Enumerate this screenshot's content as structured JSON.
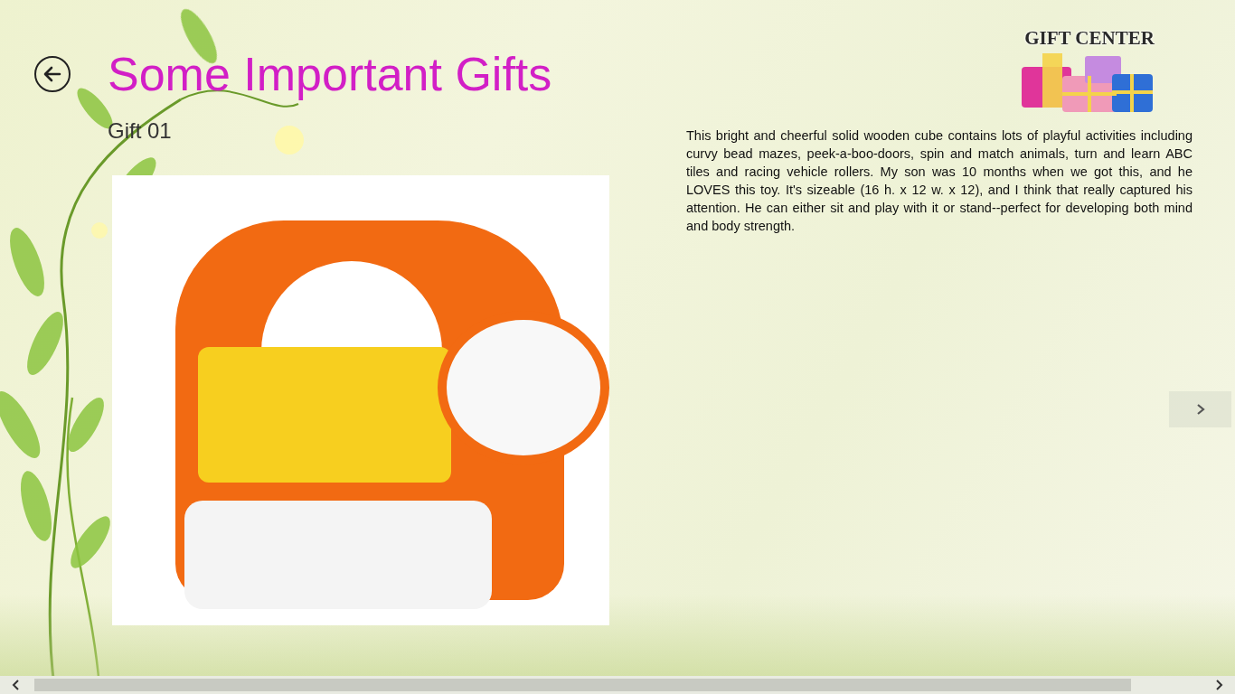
{
  "page": {
    "title": "Some Important Gifts",
    "subtitle": "Gift 01"
  },
  "logo": {
    "text": "GIFT CENTER"
  },
  "gift": {
    "description": "This bright and cheerful solid wooden cube contains lots of playful activities including curvy bead mazes, peek-a-boo-doors, spin and match animals, turn and learn ABC tiles and racing vehicle rollers. My son was 10 months when we got this, and he LOVES this toy. It's sizeable (16 h. x 12 w. x 12), and I think that really captured his attention. He can either sit and play with it or stand--perfect for developing both mind and body strength."
  },
  "scrollbar": {
    "level": 0.94
  }
}
